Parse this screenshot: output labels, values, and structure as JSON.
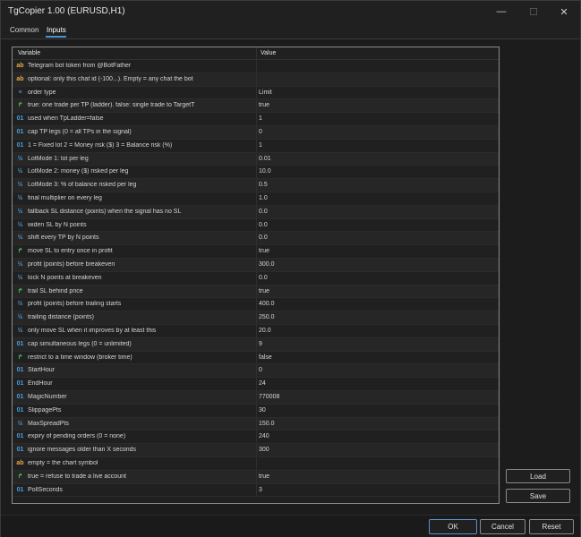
{
  "window": {
    "title": "TgCopier 1.00 (EURUSD,H1)",
    "minimize_glyph": "—",
    "maximize_glyph": "☐",
    "close_glyph": "✕"
  },
  "tabs": [
    {
      "label": "Common"
    },
    {
      "label": "Inputs"
    }
  ],
  "grid": {
    "headers": {
      "variable": "Variable",
      "value": "Value"
    },
    "rows": [
      {
        "type": "str",
        "icon": "ab",
        "name": "Telegram bot token from @BotFather",
        "value": ""
      },
      {
        "type": "str",
        "icon": "ab",
        "name": "optional: only this chat id (-100...). Empty = any chat the bot",
        "value": ""
      },
      {
        "type": "enum",
        "icon": "≡",
        "name": "order type",
        "value": "Limit"
      },
      {
        "type": "bool",
        "icon": "↱",
        "name": "true: one trade per TP (ladder). false: single trade to TargetT",
        "value": "true"
      },
      {
        "type": "int",
        "icon": "01",
        "name": "used when TpLadder=false",
        "value": "1"
      },
      {
        "type": "int",
        "icon": "01",
        "name": "cap TP legs (0 = all TPs in the signal)",
        "value": "0"
      },
      {
        "type": "int",
        "icon": "01",
        "name": "1 = Fixed lot   2 = Money risk ($)   3 = Balance risk (%)",
        "value": "1"
      },
      {
        "type": "dbl",
        "icon": "½",
        "name": "LotMode 1: lot per leg",
        "value": "0.01"
      },
      {
        "type": "dbl",
        "icon": "½",
        "name": "LotMode 2: money ($) risked per leg",
        "value": "10.0"
      },
      {
        "type": "dbl",
        "icon": "½",
        "name": "LotMode 3: % of balance risked per leg",
        "value": "0.5"
      },
      {
        "type": "dbl",
        "icon": "½",
        "name": "final multiplier on every leg",
        "value": "1.0"
      },
      {
        "type": "dbl",
        "icon": "½",
        "name": "fallback SL distance (points) when the signal has no SL",
        "value": "0.0"
      },
      {
        "type": "dbl",
        "icon": "½",
        "name": "widen SL by N points",
        "value": "0.0"
      },
      {
        "type": "dbl",
        "icon": "½",
        "name": "shift every TP by N points",
        "value": "0.0"
      },
      {
        "type": "bool",
        "icon": "↱",
        "name": "move SL to entry once in profit",
        "value": "true"
      },
      {
        "type": "dbl",
        "icon": "½",
        "name": "profit (points) before breakeven",
        "value": "300.0"
      },
      {
        "type": "dbl",
        "icon": "½",
        "name": "lock N points at breakeven",
        "value": "0.0"
      },
      {
        "type": "bool",
        "icon": "↱",
        "name": "trail SL behind price",
        "value": "true"
      },
      {
        "type": "dbl",
        "icon": "½",
        "name": "profit (points) before trailing starts",
        "value": "400.0"
      },
      {
        "type": "dbl",
        "icon": "½",
        "name": "trailing distance (points)",
        "value": "250.0"
      },
      {
        "type": "dbl",
        "icon": "½",
        "name": "only move SL when it improves by at least this",
        "value": "20.0"
      },
      {
        "type": "int",
        "icon": "01",
        "name": "cap simultaneous legs (0 = unlimited)",
        "value": "9"
      },
      {
        "type": "bool",
        "icon": "↱",
        "name": "restrict to a time window (broker time)",
        "value": "false"
      },
      {
        "type": "int",
        "icon": "01",
        "name": "StartHour",
        "value": "0"
      },
      {
        "type": "int",
        "icon": "01",
        "name": "EndHour",
        "value": "24"
      },
      {
        "type": "int",
        "icon": "01",
        "name": "MagicNumber",
        "value": "770008"
      },
      {
        "type": "int",
        "icon": "01",
        "name": "SlippagePts",
        "value": "30"
      },
      {
        "type": "dbl",
        "icon": "½",
        "name": "MaxSpreadPts",
        "value": "150.0"
      },
      {
        "type": "int",
        "icon": "01",
        "name": "expiry of pending orders (0 = none)",
        "value": "240"
      },
      {
        "type": "int",
        "icon": "01",
        "name": "ignore messages older than X seconds",
        "value": "300"
      },
      {
        "type": "str",
        "icon": "ab",
        "name": "empty = the chart symbol",
        "value": ""
      },
      {
        "type": "bool",
        "icon": "↱",
        "name": "true = refuse to trade a live account",
        "value": "true"
      },
      {
        "type": "int",
        "icon": "01",
        "name": "PollSeconds",
        "value": "3"
      }
    ]
  },
  "side_buttons": {
    "load": "Load",
    "save": "Save"
  },
  "footer": {
    "ok": "OK",
    "cancel": "Cancel",
    "reset": "Reset"
  },
  "colors": {
    "accent": "#4a90d9",
    "string_icon": "#e8a84a",
    "number_icon": "#4a9fe0",
    "bool_icon": "#3fbf5f"
  }
}
